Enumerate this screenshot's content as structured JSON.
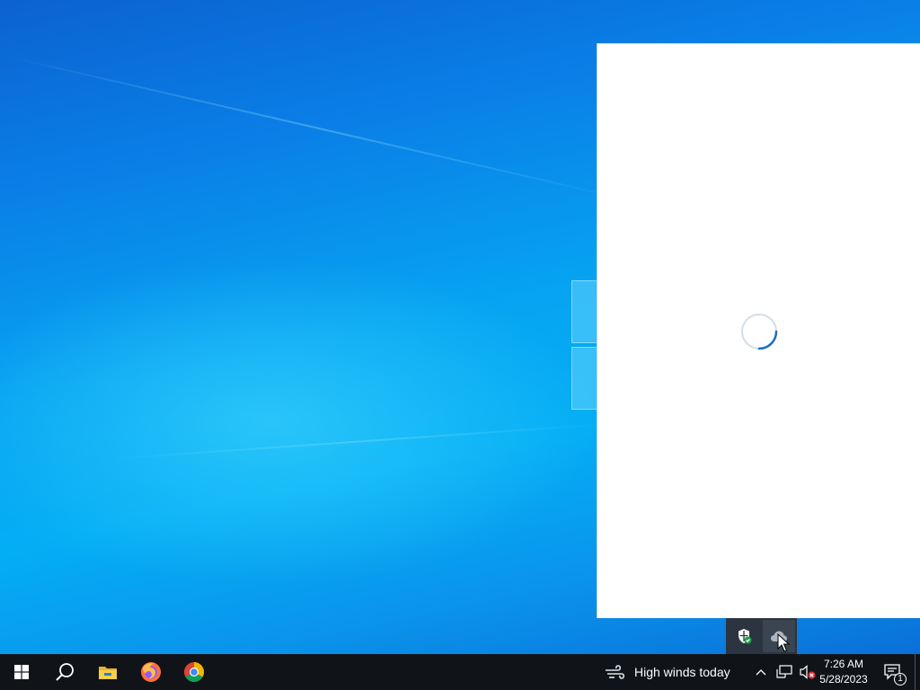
{
  "desktop": {
    "wallpaper": "windows-10-default-hero",
    "accent": "#0a7ee6"
  },
  "flyout": {
    "state": "loading",
    "spinner_color": "#1f6fc4"
  },
  "tray_overflow": {
    "items": [
      {
        "icon": "windows-security-shield-icon"
      },
      {
        "icon": "onedrive-cloud-icon"
      }
    ]
  },
  "taskbar": {
    "start_icon": "windows-logo-icon",
    "search_icon": "search-icon",
    "pinned": [
      {
        "icon": "file-explorer-icon"
      },
      {
        "icon": "firefox-icon"
      },
      {
        "icon": "chrome-icon"
      }
    ],
    "weather": {
      "icon": "wind-icon",
      "text": "High winds today"
    },
    "system_tray": [
      {
        "icon": "chevron-up-icon"
      },
      {
        "icon": "network-icon"
      },
      {
        "icon": "speaker-muted-icon"
      }
    ],
    "clock": {
      "time": "7:26 AM",
      "date": "5/28/2023"
    },
    "notifications": {
      "icon": "action-center-icon",
      "count": "1"
    }
  }
}
